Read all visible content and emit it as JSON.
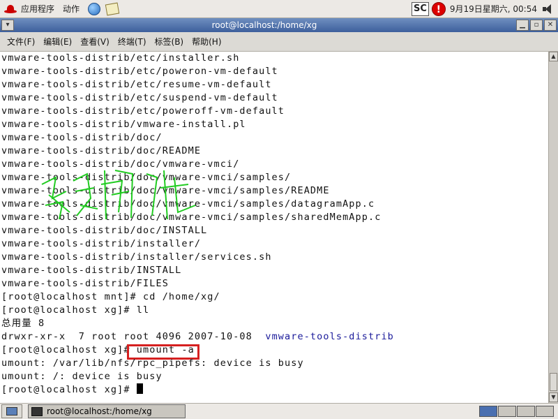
{
  "top_panel": {
    "apps_menu": "应用程序",
    "actions_menu": "动作",
    "input_method": "SC",
    "clock": "9月19日星期六, 00:54"
  },
  "window": {
    "title": "root@localhost:/home/xg"
  },
  "menubar": {
    "items": [
      "文件(F)",
      "编辑(E)",
      "查看(V)",
      "终端(T)",
      "标签(B)",
      "帮助(H)"
    ]
  },
  "terminal": {
    "lines": [
      "vmware-tools-distrib/etc/installer.sh",
      "vmware-tools-distrib/etc/poweron-vm-default",
      "vmware-tools-distrib/etc/resume-vm-default",
      "vmware-tools-distrib/etc/suspend-vm-default",
      "vmware-tools-distrib/etc/poweroff-vm-default",
      "vmware-tools-distrib/vmware-install.pl",
      "vmware-tools-distrib/doc/",
      "vmware-tools-distrib/doc/README",
      "vmware-tools-distrib/doc/vmware-vmci/",
      "vmware-tools-distrib/doc/vmware-vmci/samples/",
      "vmware-tools-distrib/doc/vmware-vmci/samples/README",
      "vmware-tools-distrib/doc/vmware-vmci/samples/datagramApp.c",
      "vmware-tools-distrib/doc/vmware-vmci/samples/sharedMemApp.c",
      "vmware-tools-distrib/doc/INSTALL",
      "vmware-tools-distrib/installer/",
      "vmware-tools-distrib/installer/services.sh",
      "vmware-tools-distrib/INSTALL",
      "vmware-tools-distrib/FILES",
      "[root@localhost mnt]# cd /home/xg/",
      "[root@localhost xg]# ll",
      "总用量 8"
    ],
    "ls_prefix": "drwxr-xr-x  7 root root 4096 2007-10-08  ",
    "ls_dirname": "vmware-tools-distrib",
    "prompt": "[root@localhost xg]# ",
    "command": "umount -a",
    "output": [
      "umount: /var/lib/nfs/rpc_pipefs: device is busy",
      "umount: /: device is busy"
    ],
    "final_prompt": "[root@localhost xg]# "
  },
  "taskbar": {
    "task_label": "root@localhost:/home/xg"
  },
  "colors": {
    "titlebar": "#4a6aa8",
    "highlight_box": "#d62020",
    "directory": "#1a1a9a",
    "watermark": "#22cc22"
  }
}
